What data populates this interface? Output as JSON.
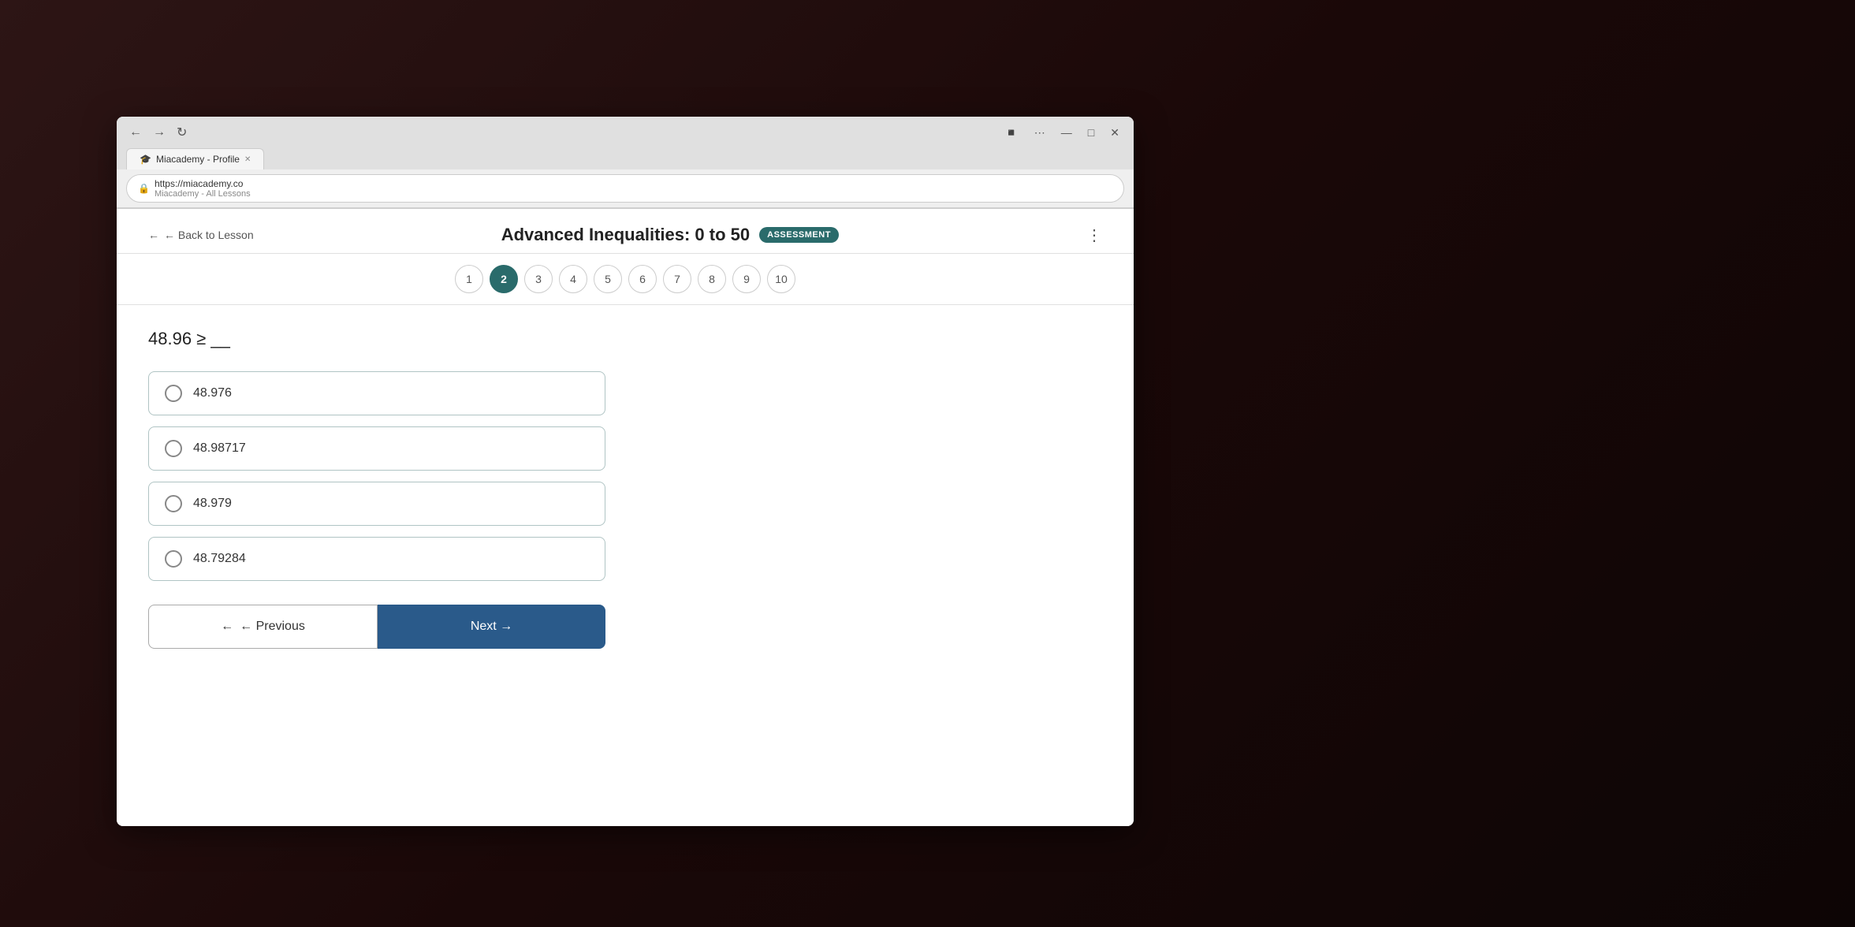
{
  "browser": {
    "tab_title": "Miacademy - Profile",
    "address_url": "https://miacademy.co",
    "address_secondary": "Miacademy - All Lessons",
    "favicon": "🎓"
  },
  "header": {
    "back_label": "← Back to Lesson",
    "title": "Advanced Inequalities: 0 to 50",
    "badge_label": "ASSESSMENT",
    "more_icon": "⋮"
  },
  "pagination": {
    "current": 2,
    "items": [
      {
        "number": "1"
      },
      {
        "number": "2"
      },
      {
        "number": "3"
      },
      {
        "number": "4"
      },
      {
        "number": "5"
      },
      {
        "number": "6"
      },
      {
        "number": "7"
      },
      {
        "number": "8"
      },
      {
        "number": "9"
      },
      {
        "number": "10"
      }
    ]
  },
  "question": {
    "text": "48.96 ≥ __",
    "options": [
      {
        "value": "48.976",
        "id": "opt1"
      },
      {
        "value": "48.98717",
        "id": "opt2"
      },
      {
        "value": "48.979",
        "id": "opt3"
      },
      {
        "value": "48.79284",
        "id": "opt4"
      }
    ]
  },
  "navigation": {
    "previous_label": "← Previous",
    "next_label": "Next →"
  }
}
